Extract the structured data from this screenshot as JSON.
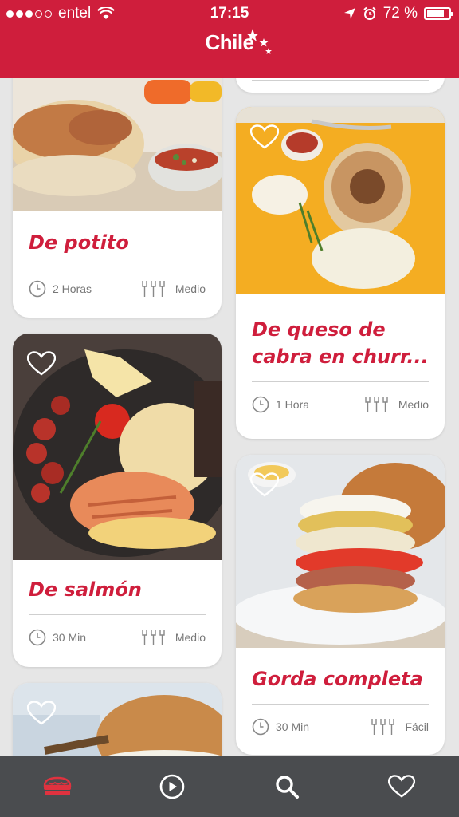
{
  "status_bar": {
    "carrier": "entel",
    "time": "17:15",
    "battery": "72 %"
  },
  "header": {
    "logo_text": "Chile"
  },
  "cards": [
    {
      "title": "De potito",
      "time": "2 Horas",
      "difficulty": "Medio"
    },
    {
      "title": "De queso de cabra en churr...",
      "time": "1 Hora",
      "difficulty": "Medio"
    },
    {
      "title": "De salmón",
      "time": "30 Min",
      "difficulty": "Medio"
    },
    {
      "title": "Gorda completa",
      "time": "30 Min",
      "difficulty": "Fácil"
    }
  ],
  "icons": {
    "favorite": "heart-outline-icon",
    "time": "clock-icon",
    "difficulty": "cutlery-icon"
  },
  "bottom_nav": [
    {
      "name": "recipes-tab",
      "icon": "sandwich-icon",
      "active": true
    },
    {
      "name": "videos-tab",
      "icon": "play-icon",
      "active": false
    },
    {
      "name": "search-tab",
      "icon": "search-icon",
      "active": false
    },
    {
      "name": "favorites-tab",
      "icon": "heart-icon",
      "active": false
    }
  ],
  "colors": {
    "brand_red": "#cf1e3c",
    "nav_bg": "#4a4c4f",
    "meta_gray": "#777777"
  }
}
